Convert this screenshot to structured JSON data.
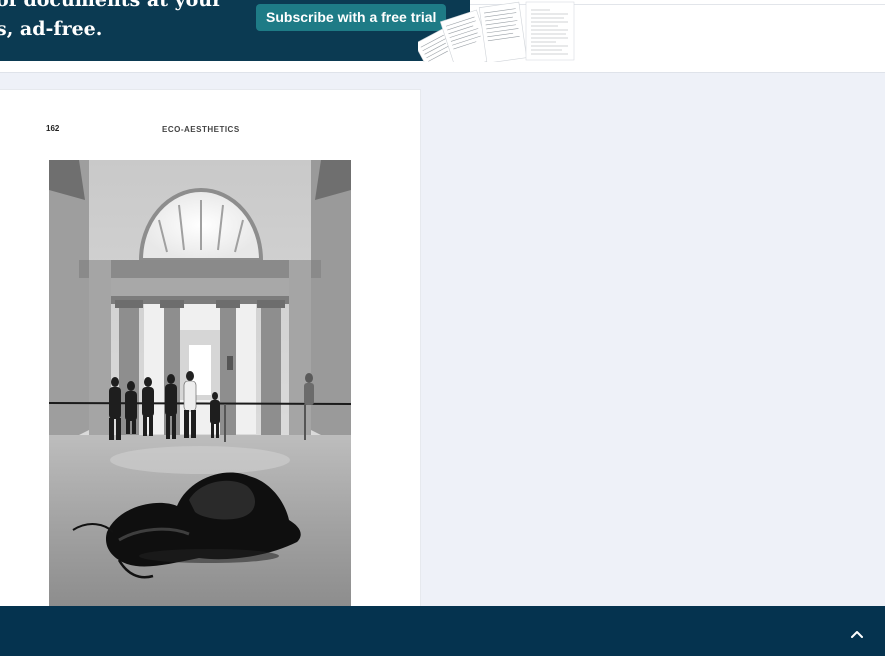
{
  "banner": {
    "line1": "of documents at your",
    "line2": "s, ad-free.",
    "cta_label": "Subscribe with a free trial",
    "decor_icon": "document-stack-illustration"
  },
  "document": {
    "page_number": "162",
    "running_head": "ECO-AESTHETICS",
    "figure_icon": "gallery-sculpture-photo"
  },
  "footer": {
    "scroll_top_icon": "chevron-up-icon"
  },
  "colors": {
    "banner_bg": "#0b3a52",
    "cta_bg": "#1e7b86",
    "footer_bg": "#05334f",
    "viewer_bg": "#eef1f8"
  }
}
